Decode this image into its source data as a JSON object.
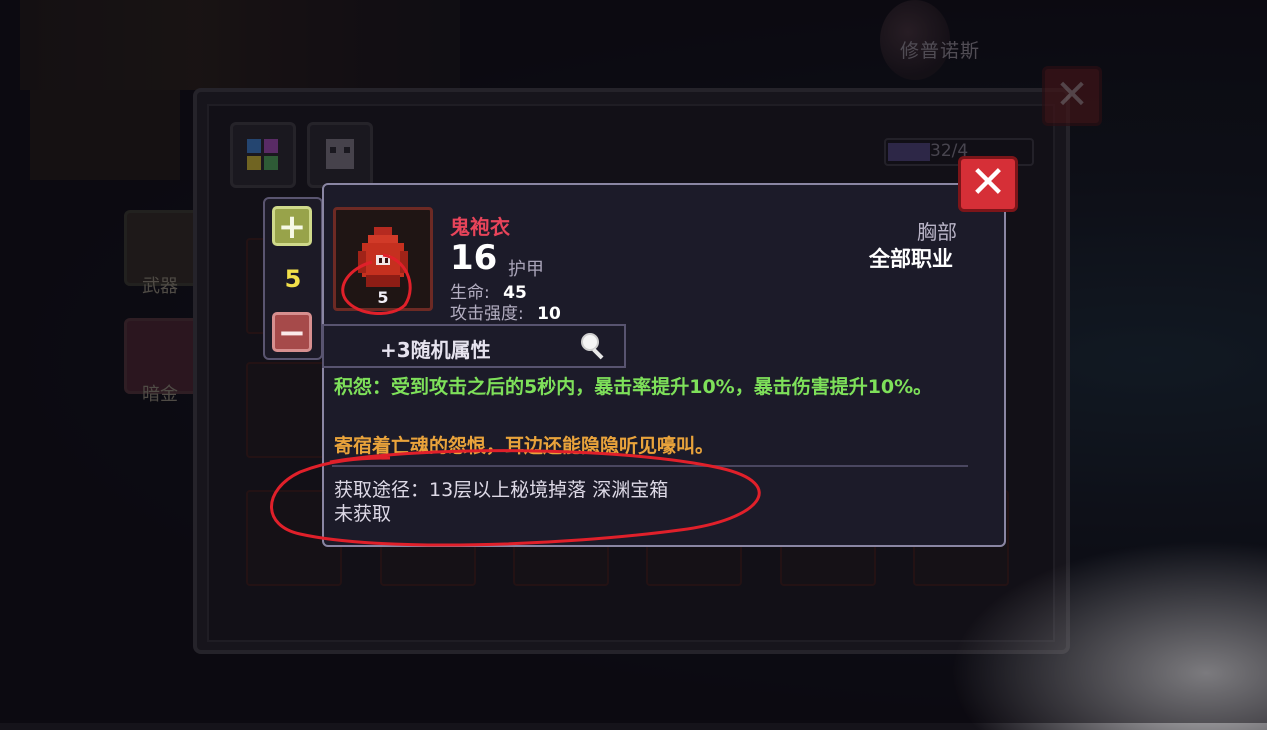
{
  "background": {
    "boss_name": "修普诺斯",
    "side_buttons": [
      {
        "label": "武器"
      },
      {
        "label": "暗金"
      }
    ],
    "capacity_text": "32/4"
  },
  "stepper": {
    "plus_symbol": "+",
    "minus_symbol": "−",
    "value": "5"
  },
  "item": {
    "name": "鬼袍衣",
    "level": "5",
    "armor_value": "16",
    "armor_label": "护甲",
    "stats": [
      {
        "label": "生命:",
        "value": "45"
      },
      {
        "label": "攻击强度:",
        "value": "10"
      }
    ],
    "slot": "胸部",
    "class": "全部职业",
    "random_attr": "+3随机属性",
    "effect": "积怨：受到攻击之后的5秒内，暴击率提升10%，暴击伤害提升10%。",
    "flavor": "寄宿着亡魂的怨恨，耳边还能隐隐听见嚎叫。",
    "source": "获取途径：13层以上秘境掉落 深渊宝箱",
    "obtained": "未获取"
  },
  "buttons": {
    "close_symbol": "✕",
    "outer_close_symbol": "✕"
  },
  "colors": {
    "item_name": "#e8445a",
    "effect": "#7ee05a",
    "flavor": "#e9a33b",
    "annotation": "#e0202a"
  },
  "icons": {
    "tab1": "grid-icon",
    "tab2": "monster-icon",
    "inspect": "magnifier-icon",
    "item": "robe-icon"
  }
}
